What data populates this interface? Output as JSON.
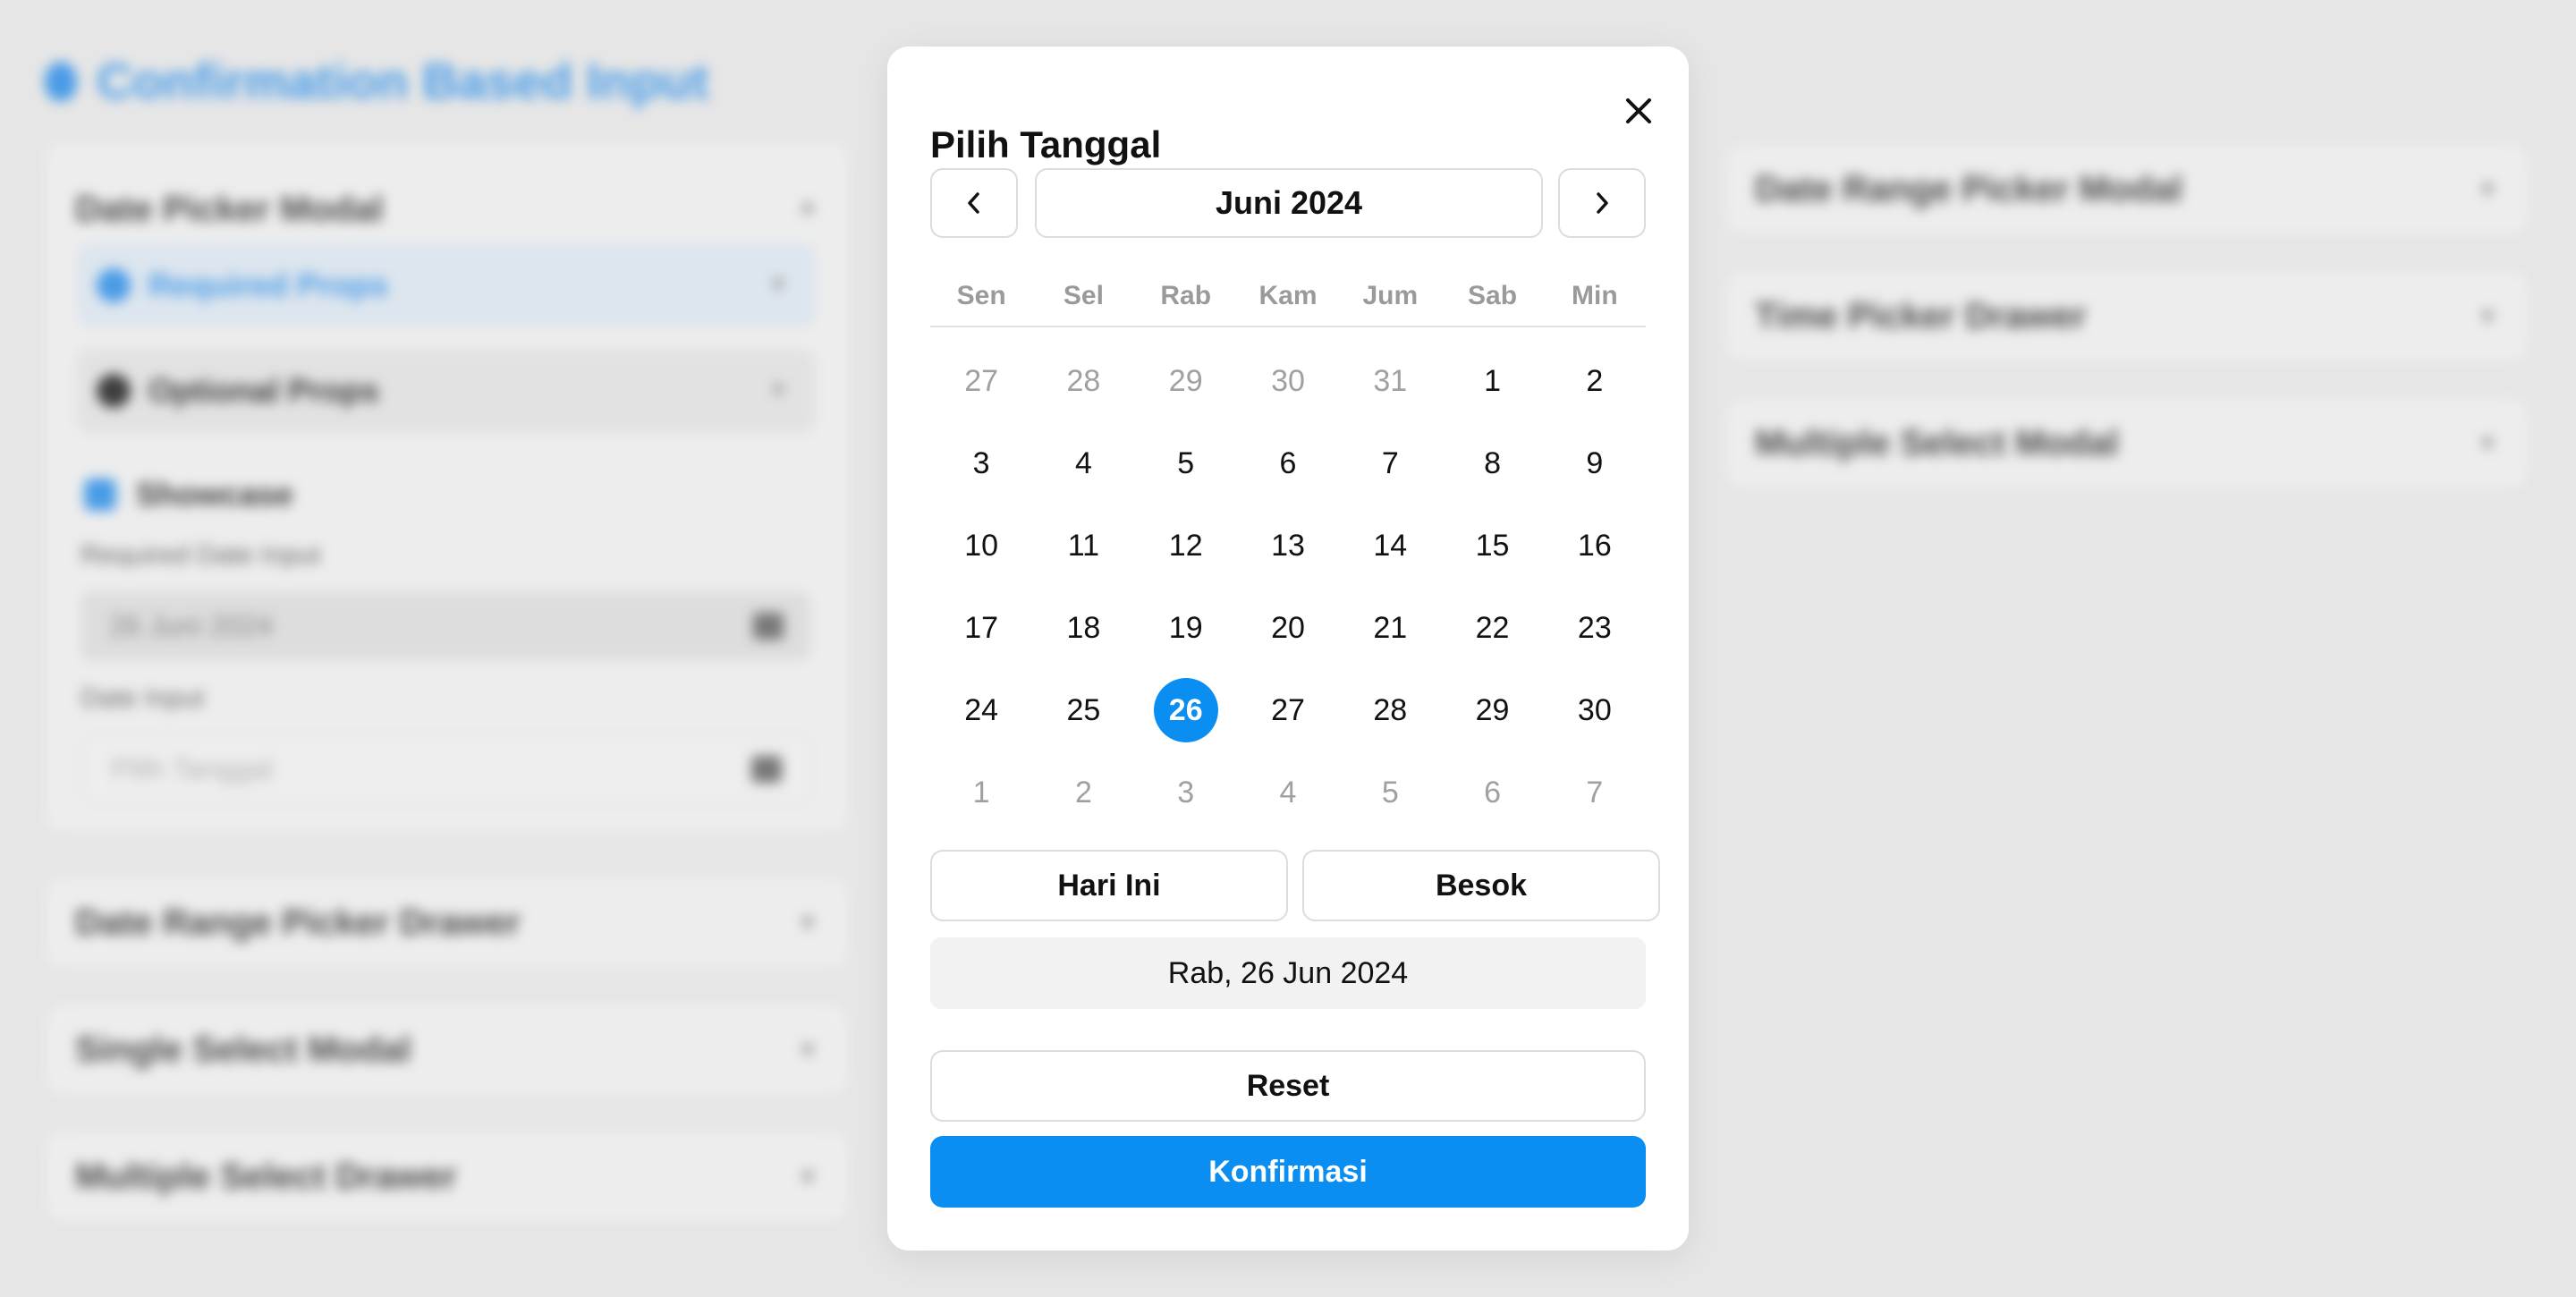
{
  "background": {
    "page_title": "Confirmation Based Input",
    "left_column": {
      "date_picker_modal": {
        "title": "Date Picker Modal",
        "required_props": "Required Props",
        "optional_props": "Optional Props",
        "showcase_label": "Showcase",
        "required_date_input_label": "Required Date Input",
        "required_date_input_value": "26 Juni 2024",
        "date_input_label": "Date Input",
        "date_input_placeholder": "Pilih Tanggal"
      },
      "sections": [
        "Date Range Picker Drawer",
        "Single Select Modal",
        "Multiple Select Drawer"
      ]
    },
    "right_column": {
      "sections": [
        "Date Range Picker Modal",
        "Time Picker Drawer",
        "Multiple Select Modal"
      ]
    }
  },
  "modal": {
    "title": "Pilih Tanggal",
    "close_icon": "close-icon",
    "prev_icon": "chevron-left-icon",
    "next_icon": "chevron-right-icon",
    "month_label": "Juni 2024",
    "weekdays": [
      "Sen",
      "Sel",
      "Rab",
      "Kam",
      "Jum",
      "Sab",
      "Min"
    ],
    "days": [
      {
        "d": "27",
        "muted": true
      },
      {
        "d": "28",
        "muted": true
      },
      {
        "d": "29",
        "muted": true
      },
      {
        "d": "30",
        "muted": true
      },
      {
        "d": "31",
        "muted": true
      },
      {
        "d": "1"
      },
      {
        "d": "2"
      },
      {
        "d": "3"
      },
      {
        "d": "4"
      },
      {
        "d": "5"
      },
      {
        "d": "6"
      },
      {
        "d": "7"
      },
      {
        "d": "8"
      },
      {
        "d": "9"
      },
      {
        "d": "10"
      },
      {
        "d": "11"
      },
      {
        "d": "12"
      },
      {
        "d": "13"
      },
      {
        "d": "14"
      },
      {
        "d": "15"
      },
      {
        "d": "16"
      },
      {
        "d": "17"
      },
      {
        "d": "18"
      },
      {
        "d": "19"
      },
      {
        "d": "20"
      },
      {
        "d": "21"
      },
      {
        "d": "22"
      },
      {
        "d": "23"
      },
      {
        "d": "24"
      },
      {
        "d": "25"
      },
      {
        "d": "26",
        "selected": true
      },
      {
        "d": "27"
      },
      {
        "d": "28"
      },
      {
        "d": "29"
      },
      {
        "d": "30"
      },
      {
        "d": "1",
        "muted": true
      },
      {
        "d": "2",
        "muted": true
      },
      {
        "d": "3",
        "muted": true
      },
      {
        "d": "4",
        "muted": true
      },
      {
        "d": "5",
        "muted": true
      },
      {
        "d": "6",
        "muted": true
      },
      {
        "d": "7",
        "muted": true
      }
    ],
    "today_label": "Hari Ini",
    "tomorrow_label": "Besok",
    "selected_date_text": "Rab, 26 Jun 2024",
    "reset_label": "Reset",
    "confirm_label": "Konfirmasi",
    "accent_color": "#0a8ef2"
  }
}
